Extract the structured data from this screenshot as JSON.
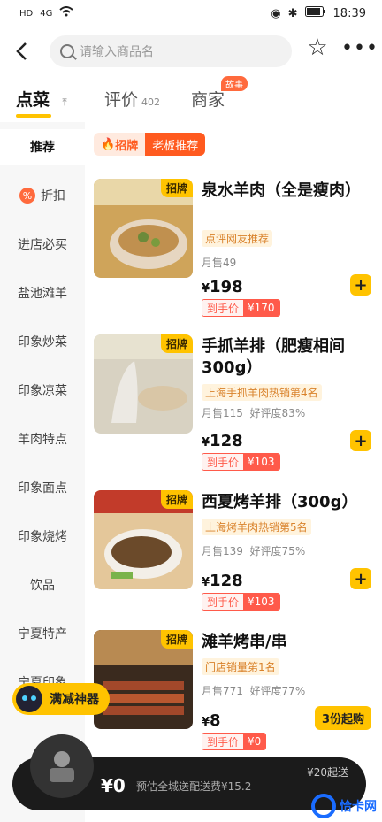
{
  "status": {
    "left_items": [
      "HD",
      "4G",
      "wifi"
    ],
    "time": "18:39"
  },
  "header": {
    "back_icon": "chevron-left-icon",
    "search_placeholder": "请输入商品名",
    "favorite_icon": "star-icon",
    "more_icon": "more-icon"
  },
  "tabs": [
    {
      "label": "点菜",
      "count": "",
      "active": true
    },
    {
      "label": "评价",
      "count": "402",
      "active": false
    },
    {
      "label": "商家",
      "count": "",
      "badge": "故事",
      "active": false
    }
  ],
  "sidebar": {
    "items": [
      "推荐",
      "折扣",
      "进店必买",
      "盐池滩羊",
      "印象炒菜",
      "印象凉菜",
      "羊肉特点",
      "印象面点",
      "印象烧烤",
      "饮品",
      "宁夏特产",
      "宁夏印象"
    ],
    "active_index": 0
  },
  "section": {
    "tag_main": "招牌",
    "tag_sub": "老板推荐"
  },
  "dishes": [
    {
      "corner": "招牌",
      "name": "泉水羊肉（全是瘦肉）",
      "rank": "点评网友推荐",
      "sales": "月售49",
      "rating": "",
      "price": "198",
      "deal_label": "到手价",
      "deal_price": "¥170",
      "action": "add"
    },
    {
      "corner": "招牌",
      "name": "手抓羊排（肥瘦相间300g）",
      "rank": "上海手抓羊肉热销第4名",
      "sales": "月售115",
      "rating": "好评度83%",
      "price": "128",
      "deal_label": "到手价",
      "deal_price": "¥103",
      "action": "add"
    },
    {
      "corner": "招牌",
      "name": "西夏烤羊排（300g）",
      "rank": "上海烤羊肉热销第5名",
      "sales": "月售139",
      "rating": "好评度75%",
      "price": "128",
      "deal_label": "到手价",
      "deal_price": "¥103",
      "action": "add"
    },
    {
      "corner": "招牌",
      "name": "滩羊烤串/串",
      "rank": "门店销量第1名",
      "sales": "月售771",
      "rating": "好评度77%",
      "price": "8",
      "deal_label": "到手价",
      "deal_price": "¥0",
      "action": "3份起购"
    }
  ],
  "helper": {
    "label": "满减神器"
  },
  "cart": {
    "total": "¥0",
    "delivery": "预估全城送配送费¥15.2",
    "min_order": "¥20起送"
  },
  "watermark": {
    "text": "恰卡网"
  }
}
